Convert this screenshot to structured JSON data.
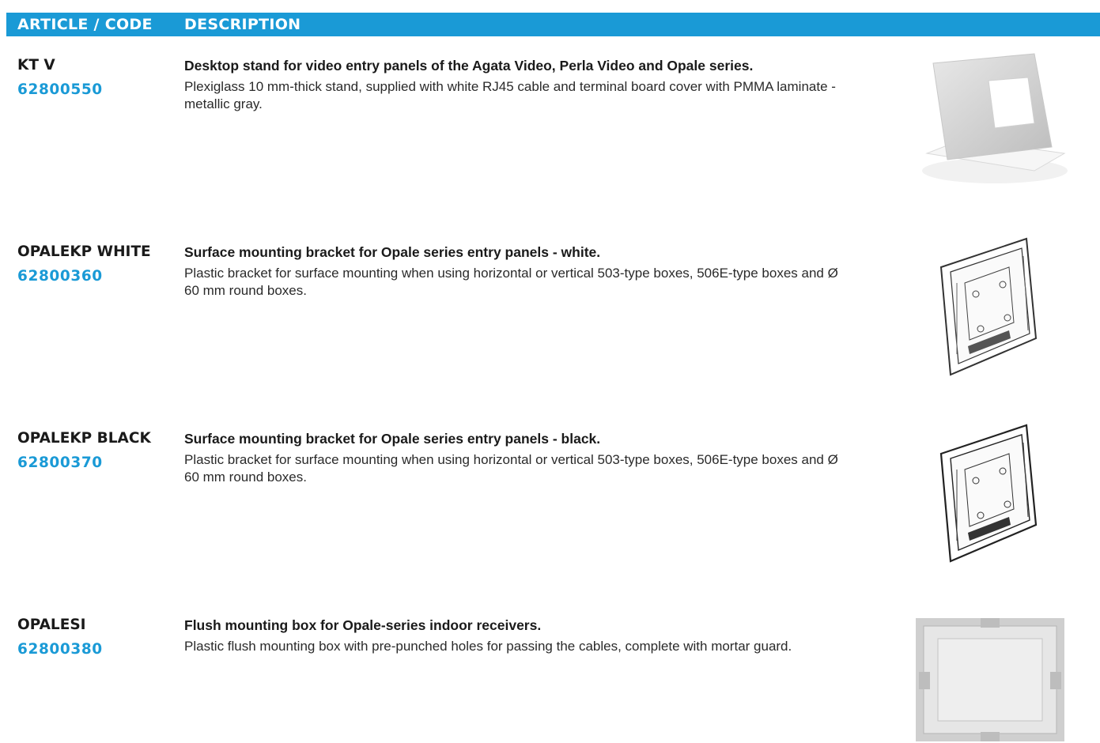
{
  "header": {
    "article_code": "ARTICLE / CODE",
    "description": "DESCRIPTION"
  },
  "accent_color": "#1a9ad6",
  "rows": [
    {
      "article": "KT V",
      "code": "62800550",
      "title": "Desktop stand for video entry panels of the Agata Video, Perla Video and Opale series.",
      "body": "Plexiglass 10 mm-thick stand, supplied with white RJ45 cable and terminal board cover with PMMA laminate - metallic gray.",
      "image": "desktop-stand-image"
    },
    {
      "article": "OPALEKP WHITE",
      "code": "62800360",
      "title": "Surface mounting bracket for Opale series entry panels - white.",
      "body": "Plastic bracket for surface mounting when using horizontal or vertical 503-type boxes, 506E-type boxes and Ø 60 mm round boxes.",
      "image": "white-bracket-image"
    },
    {
      "article": "OPALEKP BLACK",
      "code": "62800370",
      "title": "Surface mounting bracket for Opale series entry panels - black.",
      "body": "Plastic bracket for surface mounting when using horizontal or vertical 503-type boxes, 506E-type boxes and Ø 60 mm round boxes.",
      "image": "black-bracket-image"
    },
    {
      "article": "OPALESI",
      "code": "62800380",
      "title": "Flush mounting box for Opale-series indoor receivers.",
      "body": "Plastic flush mounting box with pre-punched holes for passing the cables, complete with mortar guard.",
      "image": "flush-box-image"
    }
  ]
}
